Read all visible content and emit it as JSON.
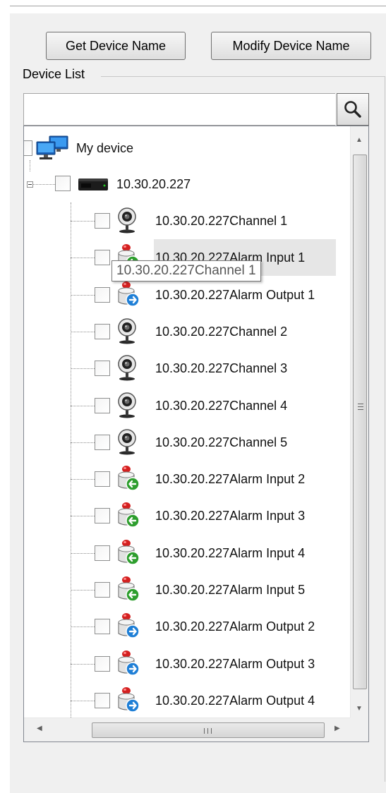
{
  "toolbar": {
    "get_device_name_label": "Get Device Name",
    "modify_device_name_label": "Modify Device Name"
  },
  "device_list": {
    "title": "Device List",
    "search": {
      "value": "",
      "placeholder": ""
    }
  },
  "tree": {
    "root_label": "My device",
    "device_label": "10.30.20.227",
    "children": [
      {
        "label": "10.30.20.227Channel 1",
        "type": "channel"
      },
      {
        "label": "10.30.20.227Alarm Input 1",
        "type": "alarm-input"
      },
      {
        "label": "10.30.20.227Alarm Output 1",
        "type": "alarm-output"
      },
      {
        "label": "10.30.20.227Channel 2",
        "type": "channel"
      },
      {
        "label": "10.30.20.227Channel 3",
        "type": "channel"
      },
      {
        "label": "10.30.20.227Channel 4",
        "type": "channel"
      },
      {
        "label": "10.30.20.227Channel 5",
        "type": "channel"
      },
      {
        "label": "10.30.20.227Alarm Input 2",
        "type": "alarm-input"
      },
      {
        "label": "10.30.20.227Alarm Input 3",
        "type": "alarm-input"
      },
      {
        "label": "10.30.20.227Alarm Input 4",
        "type": "alarm-input"
      },
      {
        "label": "10.30.20.227Alarm Input 5",
        "type": "alarm-input"
      },
      {
        "label": "10.30.20.227Alarm Output 2",
        "type": "alarm-output"
      },
      {
        "label": "10.30.20.227Alarm Output 3",
        "type": "alarm-output"
      },
      {
        "label": "10.30.20.227Alarm Output 4",
        "type": "alarm-output"
      }
    ],
    "tooltip": "10.30.20.227Channel 1"
  },
  "icons": {
    "search": "magnifier-icon",
    "root": "network-computers-icon",
    "device": "dvr-device-icon",
    "channel": "webcam-icon",
    "alarm_input": "alarm-input-icon",
    "alarm_output": "alarm-output-icon"
  },
  "colors": {
    "alarm_input_arrow": "#2e9e2e",
    "alarm_output_arrow": "#1f7fd6",
    "alarm_light": "#d42020",
    "monitor_blue": "#1e73d2"
  }
}
